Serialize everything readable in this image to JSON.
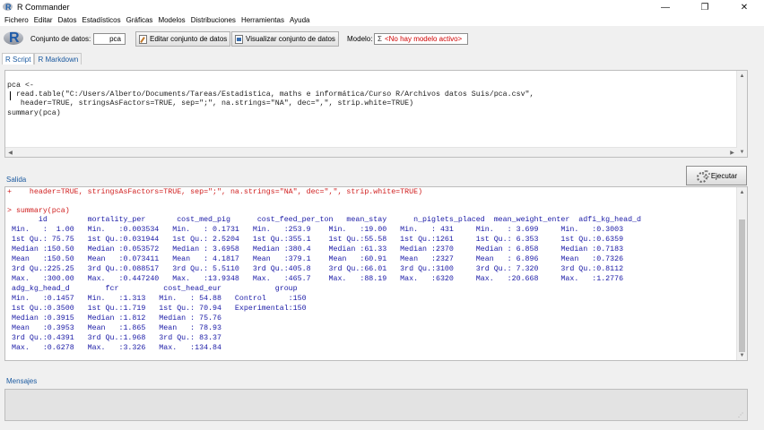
{
  "window": {
    "title": "R Commander",
    "controls": {
      "minimize": "—",
      "maximize": "❐",
      "close": "✕"
    }
  },
  "menu": [
    "Fichero",
    "Editar",
    "Datos",
    "Estadísticos",
    "Gráficas",
    "Modelos",
    "Distribuciones",
    "Herramientas",
    "Ayuda"
  ],
  "toolbar": {
    "dataset_label": "Conjunto de datos:",
    "dataset_value": "pca",
    "edit_button": "Editar conjunto de datos",
    "view_button": "Visualizar conjunto de datos",
    "model_label": "Modelo:",
    "model_prefix": "Σ",
    "model_value": "<No hay modelo activo>"
  },
  "tabs": [
    "R Script",
    "R Markdown"
  ],
  "script": {
    "lines": [
      "pca <-",
      "  read.table(\"C:/Users/Alberto/Documents/Tareas/Estadistica, maths e informática/Curso R/Archivos datos Suis/pca.csv\",",
      "   header=TRUE, stringsAsFactors=TRUE, sep=\";\", na.strings=\"NA\", dec=\",\", strip.white=TRUE)",
      "summary(pca)"
    ]
  },
  "output": {
    "label": "Salida",
    "execute_button": "Ejecutar",
    "cmd_lines": [
      "+    header=TRUE, stringsAsFactors=TRUE, sep=\";\", na.strings=\"NA\", dec=\",\", strip.white=TRUE)",
      "",
      "> summary(pca)"
    ],
    "result_lines": [
      "       id         mortality_per       cost_med_pig      cost_feed_per_ton   mean_stay      n_piglets_placed  mean_weight_enter  adfi_kg_head_d",
      " Min.   :  1.00   Min.   :0.003534   Min.   : 0.1731   Min.   :253.9    Min.   :19.00   Min.   : 431     Min.   : 3.699     Min.   :0.3003",
      " 1st Qu.: 75.75   1st Qu.:0.031944   1st Qu.: 2.5204   1st Qu.:355.1    1st Qu.:55.58   1st Qu.:1261     1st Qu.: 6.353     1st Qu.:0.6359",
      " Median :150.50   Median :0.053572   Median : 3.6958   Median :380.4    Median :61.33   Median :2370     Median : 6.858     Median :0.7183",
      " Mean   :150.50   Mean   :0.073411   Mean   : 4.1817   Mean   :379.1    Mean   :60.91   Mean   :2327     Mean   : 6.896     Mean   :0.7326",
      " 3rd Qu.:225.25   3rd Qu.:0.088517   3rd Qu.: 5.5110   3rd Qu.:405.8    3rd Qu.:66.01   3rd Qu.:3100     3rd Qu.: 7.320     3rd Qu.:0.8112",
      " Max.   :300.00   Max.   :0.447240   Max.   :13.9348   Max.   :465.7    Max.   :88.19   Max.   :6320     Max.   :20.668     Max.   :1.2776",
      " adg_kg_head_d        fcr          cost_head_eur            group",
      " Min.   :0.1457   Min.   :1.313   Min.   : 54.88   Control     :150",
      " 1st Qu.:0.3500   1st Qu.:1.719   1st Qu.: 70.94   Experimental:150",
      " Median :0.3915   Median :1.812   Median : 75.76",
      " Mean   :0.3953   Mean   :1.865   Mean   : 78.93",
      " 3rd Qu.:0.4391   3rd Qu.:1.968   3rd Qu.: 83.37",
      " Max.   :0.6278   Max.   :3.326   Max.   :134.84"
    ]
  },
  "messages": {
    "label": "Mensajes"
  }
}
